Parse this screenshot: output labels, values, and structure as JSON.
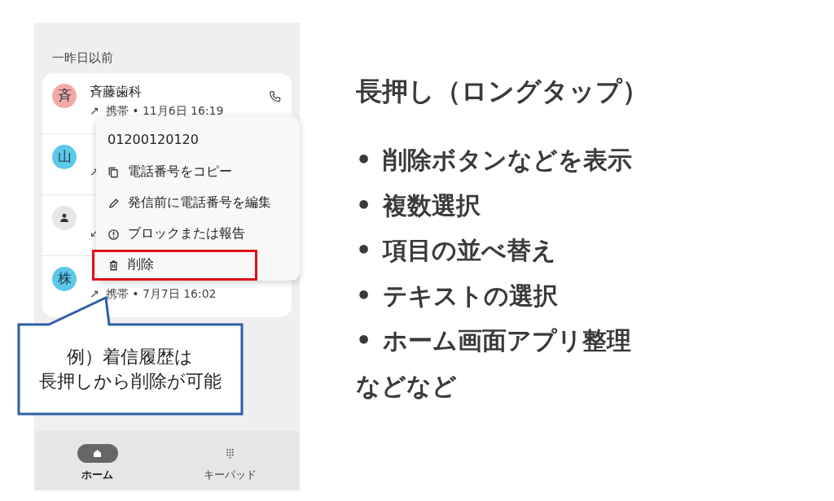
{
  "phone": {
    "section_label": "一昨日以前",
    "calls": [
      {
        "kind": "letter",
        "avatar": "斉",
        "color": "#f4aaa4",
        "name": "斉藤歯科",
        "arrow": "↗",
        "detail": "携帯 • 11月6日 16:19",
        "call_icon": true
      },
      {
        "kind": "letter",
        "avatar": "山",
        "color": "#5ec8e8",
        "arrow": "↗"
      },
      {
        "kind": "person",
        "arrow": "↙"
      },
      {
        "kind": "letter",
        "avatar": "株",
        "color": "#5ec8e8",
        "arrow": "↗",
        "detail": "携帯 • 7月7日 16:02"
      }
    ],
    "menu": {
      "number": "01200120120",
      "items": [
        {
          "kind": "copy",
          "label": "電話番号をコピー",
          "highlighted": false
        },
        {
          "kind": "edit",
          "label": "発信前に電話番号を編集",
          "highlighted": false
        },
        {
          "kind": "info",
          "label": "ブロックまたは報告",
          "highlighted": false
        },
        {
          "kind": "trash",
          "label": "削除",
          "highlighted": true
        }
      ]
    },
    "nav": [
      {
        "kind": "home",
        "label": "ホーム",
        "selected": true
      },
      {
        "kind": "keypad",
        "label": "キーパッド",
        "selected": false
      }
    ]
  },
  "callout": {
    "lines": [
      "例）着信履歴は",
      "長押しから削除が可能"
    ]
  },
  "slide": {
    "title": "長押し（ロングタップ）",
    "bullets": [
      {
        "marker": "•",
        "text": "削除ボタンなどを表示"
      },
      {
        "marker": "•",
        "text": "複数選択"
      },
      {
        "marker": "•",
        "text": "項目の並べ替え"
      },
      {
        "marker": "•",
        "text": "テキストの選択"
      },
      {
        "marker": "•",
        "text": "ホーム画面アプリ整理"
      }
    ],
    "footer": "などなど"
  }
}
